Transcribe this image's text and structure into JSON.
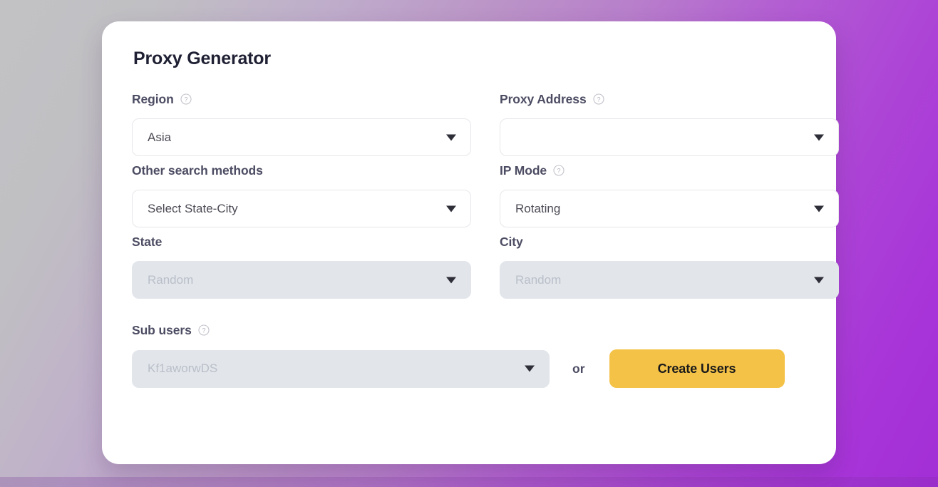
{
  "background": {
    "gradient_start": "#c2c2c4",
    "gradient_mid": "#b87fcb",
    "gradient_end": "#a22fd6"
  },
  "card": {
    "title": "Proxy Generator"
  },
  "fields": {
    "region": {
      "label": "Region",
      "help_icon": "question-circle-icon",
      "value": "Asia",
      "disabled": false
    },
    "proxy_address": {
      "label": "Proxy Address",
      "help_icon": "question-circle-icon",
      "value": "",
      "disabled": false
    },
    "other_search_methods": {
      "label": "Other search methods",
      "value": "Select State-City",
      "disabled": false
    },
    "ip_mode": {
      "label": "IP Mode",
      "help_icon": "question-circle-icon",
      "value": "Rotating",
      "disabled": false
    },
    "state": {
      "label": "State",
      "value": "Random",
      "disabled": true
    },
    "city": {
      "label": "City",
      "value": "Random",
      "disabled": true
    },
    "sub_users": {
      "label": "Sub users",
      "help_icon": "question-circle-icon",
      "value": "Kf1aworwDS",
      "disabled": true
    }
  },
  "bottom": {
    "or_label": "or",
    "create_users_label": "Create Users",
    "create_users_color": "#f4c247"
  },
  "icons": {
    "caret": "chevron-down-icon",
    "help": "question-circle-icon"
  }
}
